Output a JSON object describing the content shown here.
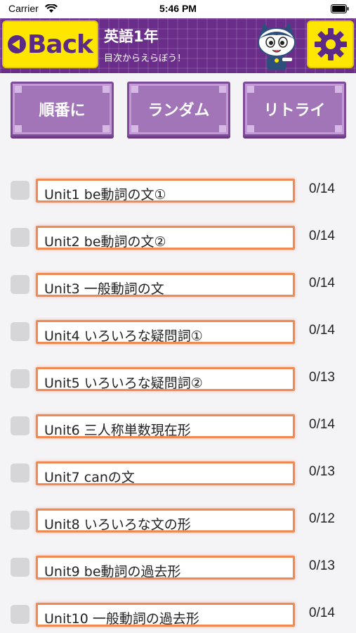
{
  "status_bar": {
    "carrier": "Carrier",
    "time": "5:46 PM",
    "icons": [
      "wifi-icon",
      "battery-icon"
    ]
  },
  "header": {
    "back_label": "Back",
    "title": "英語1年",
    "subtitle": "目次からえらぼう！",
    "mascot": "cat-mascot-icon",
    "settings_icon": "gear-icon",
    "colors": {
      "bar": "#6a2d8a",
      "button": "#ffe600",
      "button_text": "#5a2a86"
    }
  },
  "modes": [
    {
      "label": "順番に"
    },
    {
      "label": "ランダム"
    },
    {
      "label": "リトライ"
    }
  ],
  "units": [
    {
      "title": "Unit1 be動詞の文①",
      "score": "0/14"
    },
    {
      "title": "Unit2 be動詞の文②",
      "score": "0/14"
    },
    {
      "title": "Unit3 一般動詞の文",
      "score": "0/14"
    },
    {
      "title": "Unit4 いろいろな疑問詞①",
      "score": "0/14"
    },
    {
      "title": "Unit5 いろいろな疑問詞②",
      "score": "0/13"
    },
    {
      "title": "Unit6 三人称単数現在形",
      "score": "0/14"
    },
    {
      "title": "Unit7 canの文",
      "score": "0/13"
    },
    {
      "title": "Unit8 いろいろな文の形",
      "score": "0/12"
    },
    {
      "title": "Unit9 be動詞の過去形",
      "score": "0/13"
    },
    {
      "title": "Unit10 一般動詞の過去形",
      "score": "0/14"
    }
  ]
}
